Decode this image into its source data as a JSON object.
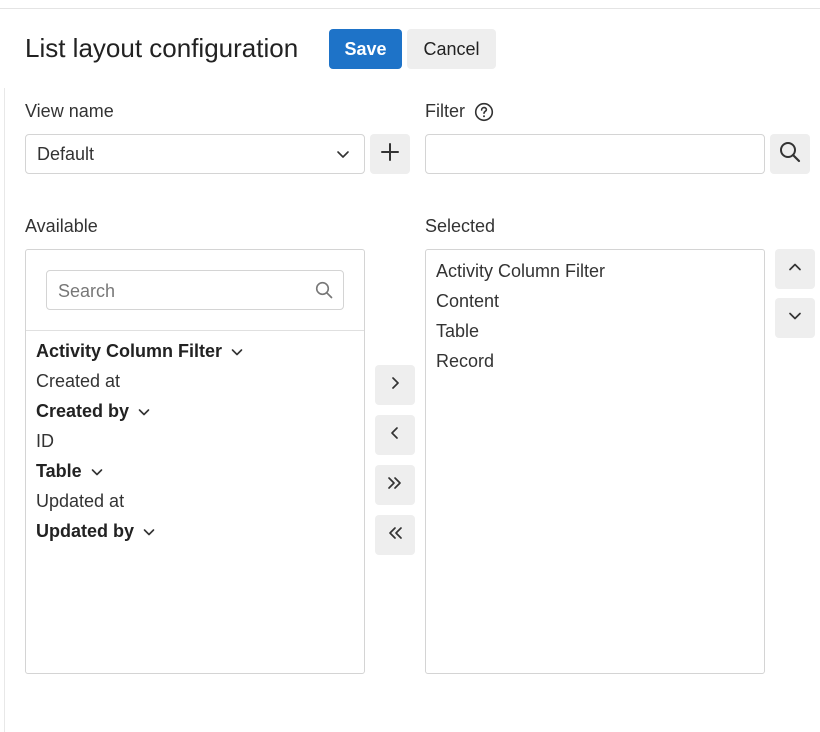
{
  "header": {
    "title": "List layout configuration",
    "save_label": "Save",
    "cancel_label": "Cancel"
  },
  "view": {
    "label": "View name",
    "selected": "Default"
  },
  "filter": {
    "label": "Filter",
    "value": ""
  },
  "available": {
    "label": "Available",
    "search_placeholder": "Search",
    "items": [
      {
        "label": "Activity Column Filter",
        "group": true
      },
      {
        "label": "Created at",
        "group": false
      },
      {
        "label": "Created by",
        "group": true
      },
      {
        "label": "ID",
        "group": false
      },
      {
        "label": "Table",
        "group": true
      },
      {
        "label": "Updated at",
        "group": false
      },
      {
        "label": "Updated by",
        "group": true
      }
    ]
  },
  "selected": {
    "label": "Selected",
    "items": [
      "Activity Column Filter",
      "Content",
      "Table",
      "Record"
    ]
  },
  "colors": {
    "primary": "#1e73c8",
    "button_gray": "#eeeeee",
    "border": "#d4d4d4"
  }
}
